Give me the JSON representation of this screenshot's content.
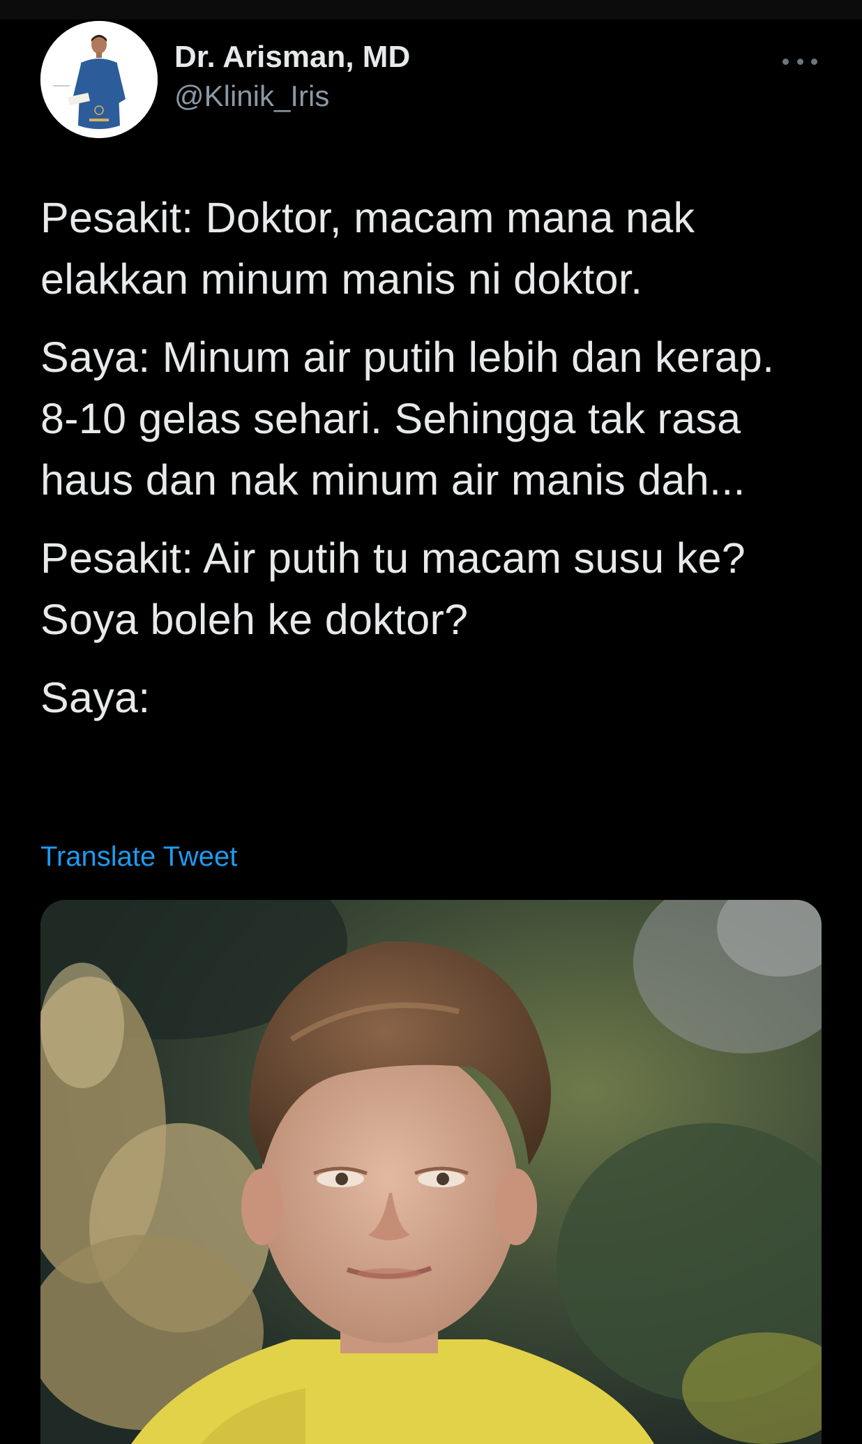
{
  "tweet": {
    "author": {
      "display_name": "Dr. Arisman, MD",
      "handle": "@Klinik_Iris"
    },
    "more_icon": "more-horizontal-icon",
    "paragraphs": [
      "Pesakit: Doktor, macam mana nak elakkan minum manis ni doktor.",
      "Saya: Minum air putih lebih dan kerap. 8-10 gelas sehari. Sehingga tak rasa haus dan nak minum air manis dah...",
      "Pesakit: Air putih tu macam susu ke? Soya boleh ke doktor?",
      "Saya:"
    ],
    "translate_label": "Translate Tweet",
    "colors": {
      "background": "#000000",
      "text": "#e7e9ea",
      "secondary_text": "#8b98a5",
      "link": "#1d9bf0"
    }
  }
}
